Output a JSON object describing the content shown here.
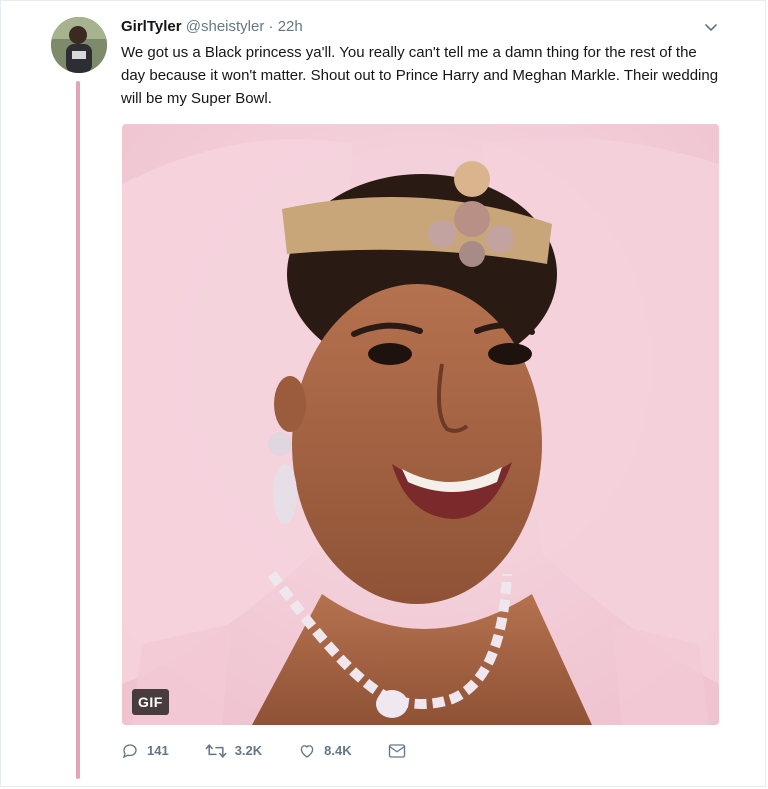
{
  "tweet": {
    "display_name": "GirlTyler",
    "handle": "@sheistyler",
    "separator": "·",
    "time": "22h",
    "text": "We got us a Black princess ya'll. You really can't tell me a damn thing for the rest of the day because it won't matter. Shout out to Prince Harry and Meghan Markle. Their wedding will be my Super Bowl.",
    "media": {
      "badge": "GIF"
    },
    "actions": {
      "replies": "141",
      "retweets": "3.2K",
      "likes": "8.4K"
    },
    "thread_line_color": "#e2a4b6"
  },
  "icons": {
    "reply": "reply-icon",
    "retweet": "retweet-icon",
    "like": "heart-icon",
    "message": "direct-message-icon",
    "menu": "chevron-down-icon"
  }
}
